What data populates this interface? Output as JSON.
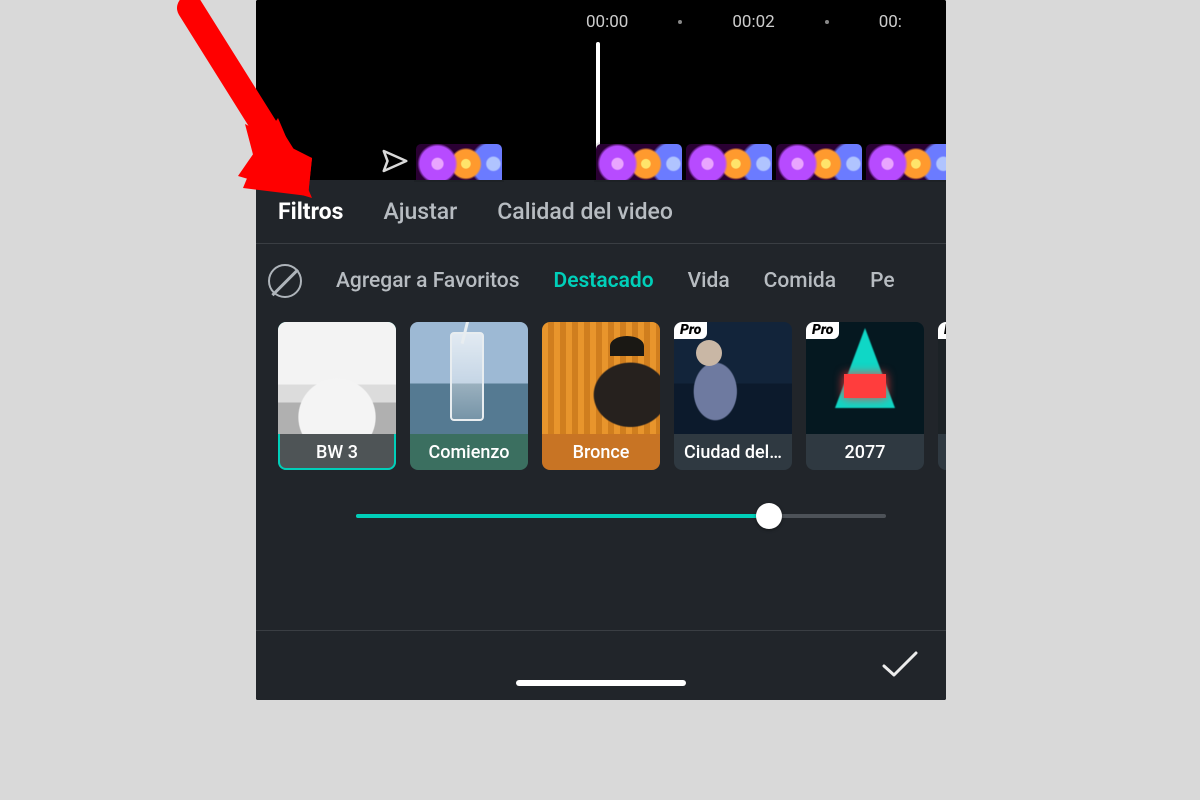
{
  "colors": {
    "accent": "#00cfb9",
    "arrow": "#ff0000"
  },
  "timeline": {
    "marks": [
      "00:00",
      "00:02"
    ],
    "partial_mark": "00:"
  },
  "tabs": {
    "active_index": 0,
    "items": [
      "Filtros",
      "Ajustar",
      "Calidad del video"
    ]
  },
  "categories": {
    "active_index": 1,
    "items": [
      "Agregar a Favoritos",
      "Destacado",
      "Vida",
      "Comida"
    ],
    "partial_item": "Pe"
  },
  "filters": {
    "selected_index": 0,
    "items": [
      {
        "label": "BW 3",
        "pro": false,
        "lbl_bg": "#4e5456",
        "thumb": "thumb-bw3"
      },
      {
        "label": "Comienzo",
        "pro": false,
        "lbl_bg": "#3b6f60",
        "thumb": "thumb-comienzo"
      },
      {
        "label": "Bronce",
        "pro": false,
        "lbl_bg": "#c87424",
        "thumb": "thumb-bronce"
      },
      {
        "label": "Ciudad del…",
        "pro": true,
        "lbl_bg": "#2f3941",
        "thumb": "thumb-ciudad"
      },
      {
        "label": "2077",
        "pro": true,
        "lbl_bg": "#2f3941",
        "thumb": "thumb-2077"
      },
      {
        "label": "",
        "pro": true,
        "lbl_bg": "#2f3941",
        "thumb": "thumb-last"
      }
    ],
    "pro_badge_text": "Pro"
  },
  "slider": {
    "percent": 78
  }
}
